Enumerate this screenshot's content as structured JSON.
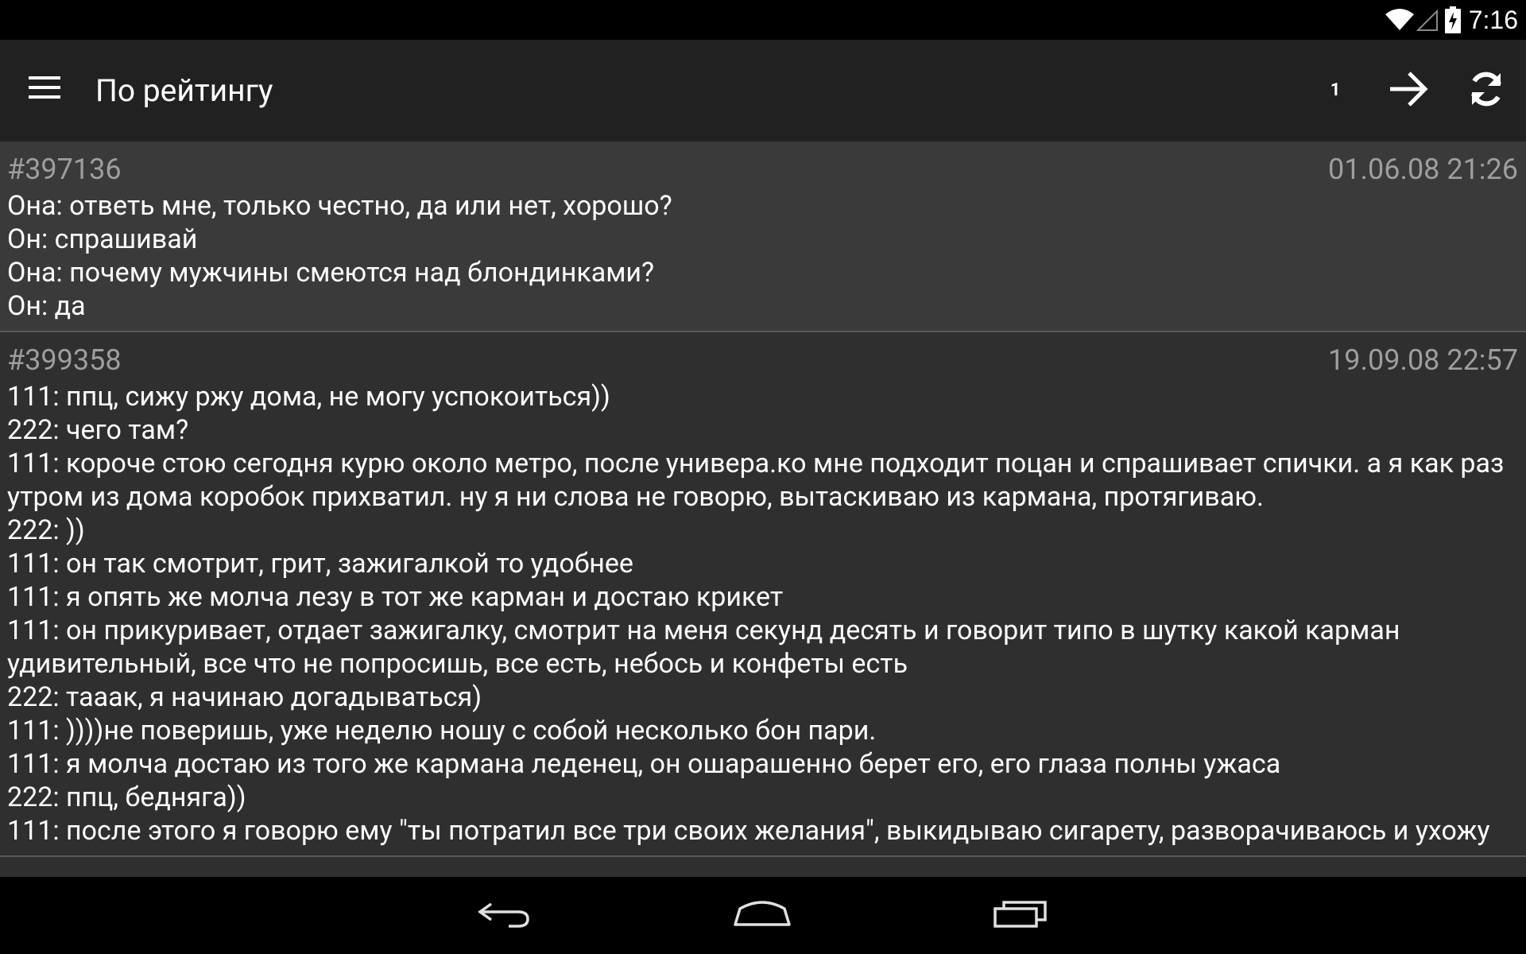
{
  "status_bar": {
    "time": "7:16",
    "icons": [
      "wifi-icon",
      "cell-signal-icon",
      "battery-charging-icon"
    ]
  },
  "action_bar": {
    "menu_icon": "hamburger-menu-icon",
    "title": "По рейтингу",
    "page_number": "1",
    "next_icon": "arrow-right-icon",
    "refresh_icon": "refresh-icon"
  },
  "quotes": [
    {
      "id": "#397136",
      "date": "01.06.08 21:26",
      "text": "Она: ответь мне, только честно, да или нет, хорошо?\nОн: спрашивай\nОна: почему мужчины смеются над блондинками?\nОн: да"
    },
    {
      "id": "#399358",
      "date": "19.09.08 22:57",
      "text": "111: ппц, сижу ржу дома, не могу успокоиться))\n222: чего там?\n111: короче стою сегодня курю около метро, после универа.ко мне подходит поцан и спрашивает спички. а я как раз утром из дома коробок прихватил. ну я ни слова не говорю, вытаскиваю из кармана, протягиваю.\n222: ))\n111: он так смотрит, грит, зажигалкой то удобнее\n111: я опять же молча лезу в тот же карман и достаю крикет\n111: он прикуривает, отдает зажигалку, смотрит на меня секунд десять и говорит типо в шутку какой карман удивительный, все что не попросишь, все есть, небось и конфеты есть\n222: тааак, я начинаю догадываться)\n111: ))))не поверишь, уже неделю ношу с собой несколько бон пари.\n111: я молча достаю из того же кармана леденец, он ошарашенно берет его, его глаза полны ужаса\n222: ппц, бедняга))\n111: после этого я говорю ему \"ты потратил все три своих желания\", выкидываю сигарету, разворачиваюсь и ухожу"
    }
  ],
  "nav_bar": {
    "buttons": [
      "back-icon",
      "home-icon",
      "recents-icon"
    ]
  },
  "colors": {
    "status_bar_bg": "#000000",
    "action_bar_bg": "#212121",
    "content_bg": "#2f2f2f",
    "first_quote_bg": "#3a3a3a",
    "meta_text": "#9e9e9e",
    "body_text": "#ffffff",
    "divider": "#5a5a5a"
  }
}
